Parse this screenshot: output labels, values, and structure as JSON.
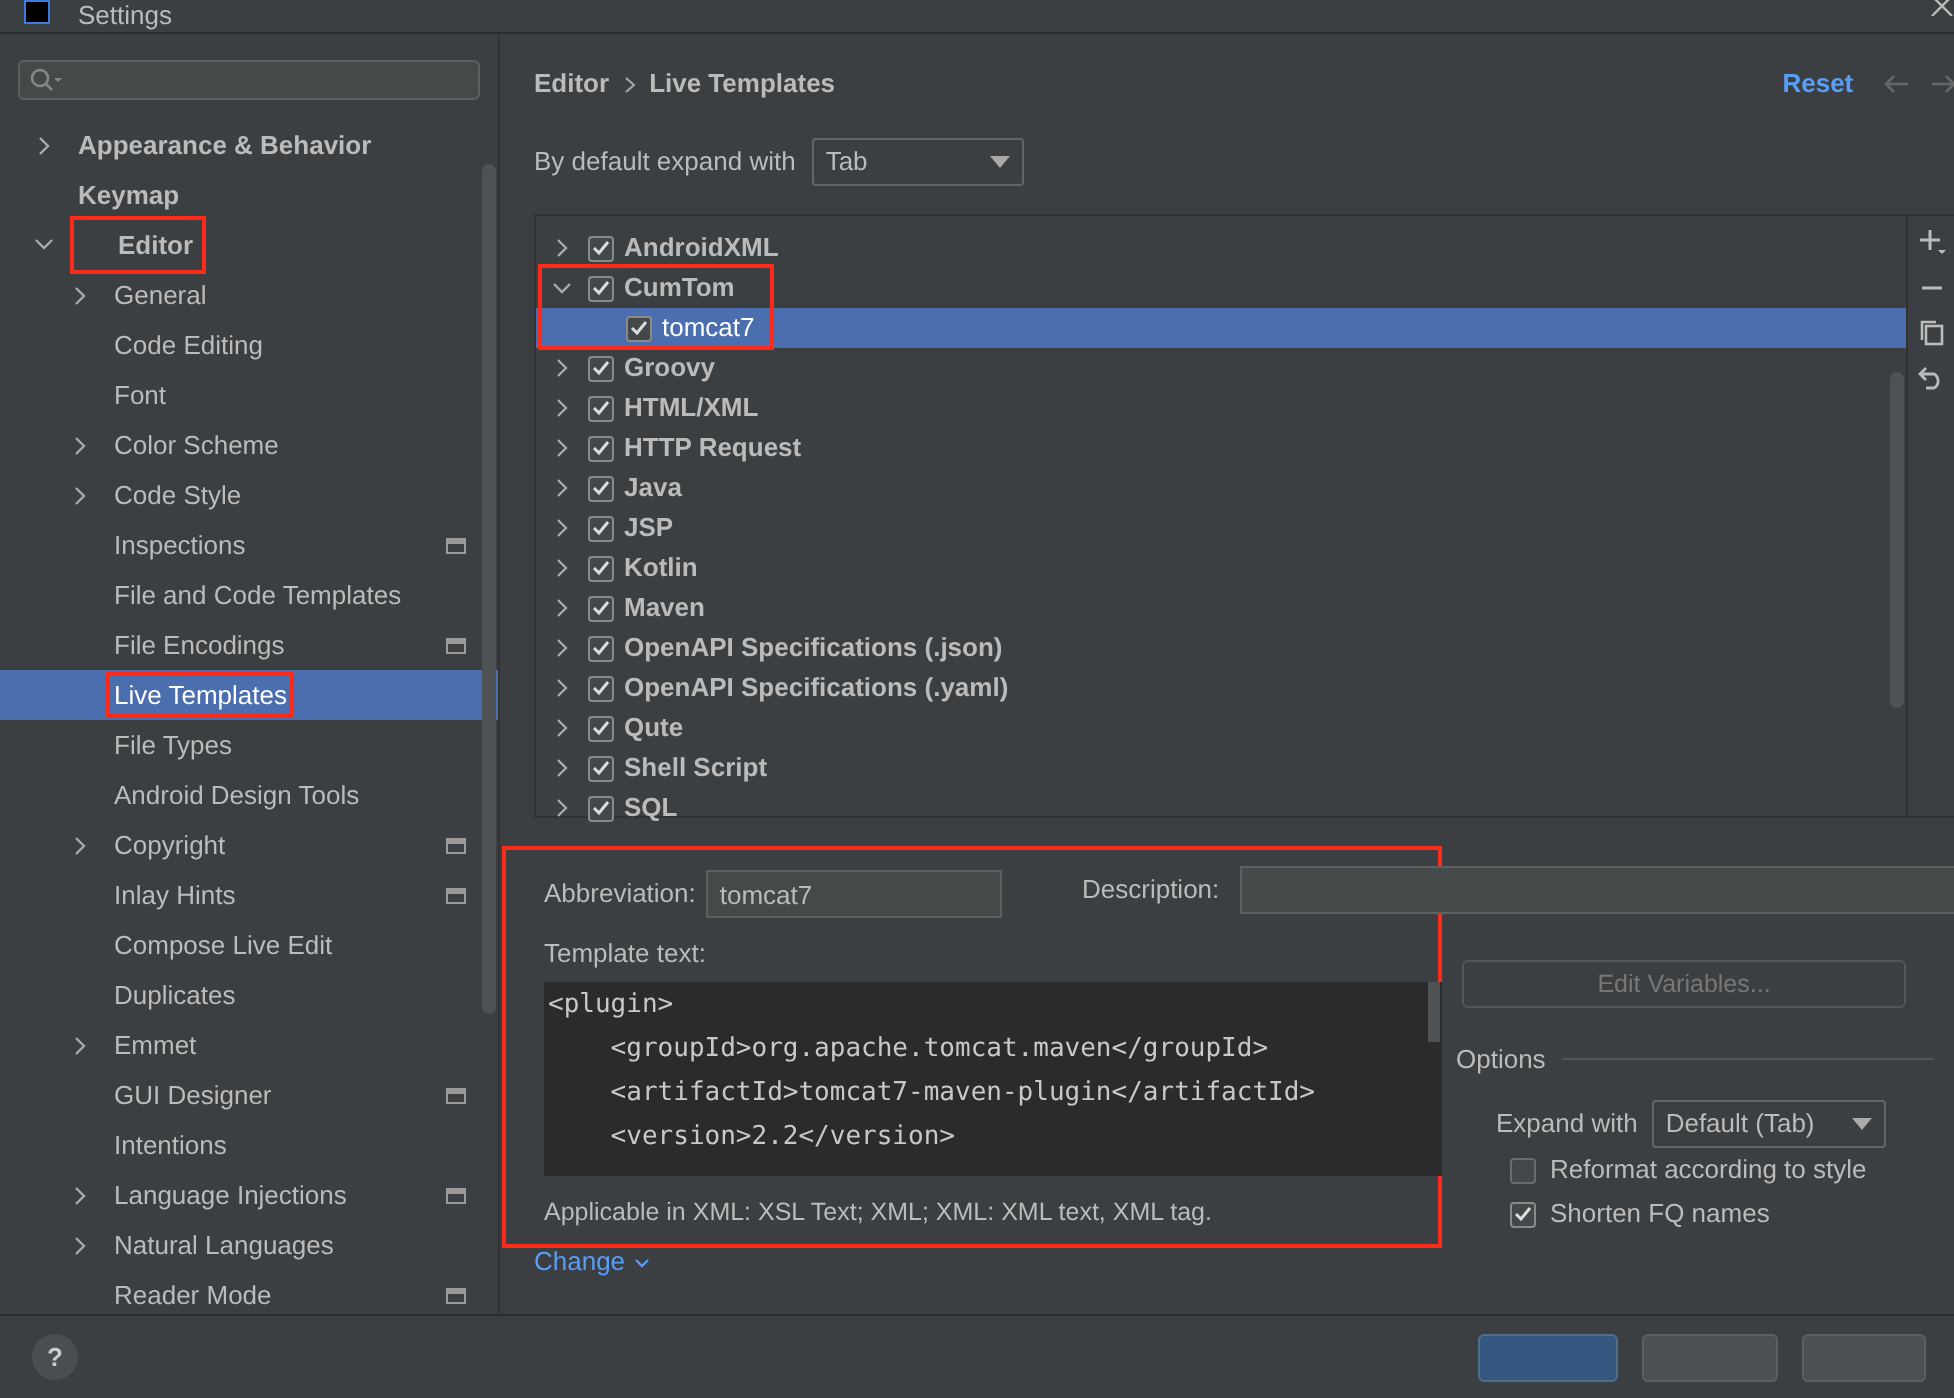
{
  "window": {
    "title": "Settings"
  },
  "sidebar": {
    "items": [
      {
        "label": "Appearance & Behavior",
        "kind": "folder",
        "expanded": false,
        "selected": false,
        "highlighted": false
      },
      {
        "label": "Keymap",
        "kind": "page",
        "selected": false,
        "highlighted": false
      },
      {
        "label": "Editor",
        "kind": "folder",
        "expanded": true,
        "selected": false,
        "highlighted": true,
        "children": [
          {
            "label": "General",
            "kind": "folder",
            "expanded": false,
            "selected": false,
            "project_scope": false,
            "highlighted": false
          },
          {
            "label": "Code Editing",
            "kind": "page",
            "selected": false,
            "project_scope": false,
            "highlighted": false
          },
          {
            "label": "Font",
            "kind": "page",
            "selected": false,
            "project_scope": false,
            "highlighted": false
          },
          {
            "label": "Color Scheme",
            "kind": "folder",
            "expanded": false,
            "selected": false,
            "project_scope": false,
            "highlighted": false
          },
          {
            "label": "Code Style",
            "kind": "folder",
            "expanded": false,
            "selected": false,
            "project_scope": false,
            "highlighted": false
          },
          {
            "label": "Inspections",
            "kind": "page",
            "selected": false,
            "project_scope": true,
            "highlighted": false
          },
          {
            "label": "File and Code Templates",
            "kind": "page",
            "selected": false,
            "project_scope": false,
            "highlighted": false
          },
          {
            "label": "File Encodings",
            "kind": "page",
            "selected": false,
            "project_scope": true,
            "highlighted": false
          },
          {
            "label": "Live Templates",
            "kind": "page",
            "selected": true,
            "project_scope": false,
            "highlighted": true
          },
          {
            "label": "File Types",
            "kind": "page",
            "selected": false,
            "project_scope": false,
            "highlighted": false
          },
          {
            "label": "Android Design Tools",
            "kind": "page",
            "selected": false,
            "project_scope": false,
            "highlighted": false
          },
          {
            "label": "Copyright",
            "kind": "folder",
            "expanded": false,
            "selected": false,
            "project_scope": true,
            "highlighted": false
          },
          {
            "label": "Inlay Hints",
            "kind": "page",
            "selected": false,
            "project_scope": true,
            "highlighted": false
          },
          {
            "label": "Compose Live Edit",
            "kind": "page",
            "selected": false,
            "project_scope": false,
            "highlighted": false
          },
          {
            "label": "Duplicates",
            "kind": "page",
            "selected": false,
            "project_scope": false,
            "highlighted": false
          },
          {
            "label": "Emmet",
            "kind": "folder",
            "expanded": false,
            "selected": false,
            "project_scope": false,
            "highlighted": false
          },
          {
            "label": "GUI Designer",
            "kind": "page",
            "selected": false,
            "project_scope": true,
            "highlighted": false
          },
          {
            "label": "Intentions",
            "kind": "page",
            "selected": false,
            "project_scope": false,
            "highlighted": false
          },
          {
            "label": "Language Injections",
            "kind": "folder",
            "expanded": false,
            "selected": false,
            "project_scope": true,
            "highlighted": false
          },
          {
            "label": "Natural Languages",
            "kind": "folder",
            "expanded": false,
            "selected": false,
            "project_scope": false,
            "highlighted": false
          },
          {
            "label": "Reader Mode",
            "kind": "page",
            "selected": false,
            "project_scope": true,
            "highlighted": false
          }
        ]
      }
    ]
  },
  "breadcrumb": [
    "Editor",
    "Live Templates"
  ],
  "reset_link": "Reset",
  "expand_default": {
    "label": "By default expand with",
    "value": "Tab"
  },
  "templates": [
    {
      "label": "AndroidXML",
      "checked": true,
      "expanded": false,
      "highlighted": false
    },
    {
      "label": "CumTom",
      "checked": true,
      "expanded": true,
      "highlighted": true,
      "children": [
        {
          "label": "tomcat7",
          "checked": true,
          "selected": true
        }
      ]
    },
    {
      "label": "Groovy",
      "checked": true,
      "expanded": false,
      "highlighted": false
    },
    {
      "label": "HTML/XML",
      "checked": true,
      "expanded": false,
      "highlighted": false
    },
    {
      "label": "HTTP Request",
      "checked": true,
      "expanded": false,
      "highlighted": false
    },
    {
      "label": "Java",
      "checked": true,
      "expanded": false,
      "highlighted": false
    },
    {
      "label": "JSP",
      "checked": true,
      "expanded": false,
      "highlighted": false
    },
    {
      "label": "Kotlin",
      "checked": true,
      "expanded": false,
      "highlighted": false
    },
    {
      "label": "Maven",
      "checked": true,
      "expanded": false,
      "highlighted": false
    },
    {
      "label": "OpenAPI Specifications (.json)",
      "checked": true,
      "expanded": false,
      "highlighted": false
    },
    {
      "label": "OpenAPI Specifications (.yaml)",
      "checked": true,
      "expanded": false,
      "highlighted": false
    },
    {
      "label": "Qute",
      "checked": true,
      "expanded": false,
      "highlighted": false
    },
    {
      "label": "Shell Script",
      "checked": true,
      "expanded": false,
      "highlighted": false
    },
    {
      "label": "SQL",
      "checked": true,
      "expanded": false,
      "highlighted": false
    }
  ],
  "details": {
    "highlighted": true,
    "abbreviation": {
      "label": "Abbreviation:",
      "value": "tomcat7"
    },
    "description": {
      "label": "Description:"
    },
    "template_label": "Template text:",
    "template_lines": [
      "<plugin>",
      "    <groupId>org.apache.tomcat.maven</groupId>",
      "    <artifactId>tomcat7-maven-plugin</artifactId>",
      "    <version>2.2</version>"
    ],
    "applicable": "Applicable in XML: XSL Text; XML; XML: XML text, XML tag.",
    "change_link": "Change",
    "edit_variables": {
      "label": "Edit Variables...",
      "disabled": true
    },
    "options_title": "Options",
    "expand_with": {
      "label": "Expand with",
      "value": "Default (Tab)"
    },
    "options": [
      {
        "label": "Reformat according to style",
        "checked": false
      },
      {
        "label": "Shorten FQ names",
        "checked": true
      }
    ]
  },
  "help_button": "?"
}
